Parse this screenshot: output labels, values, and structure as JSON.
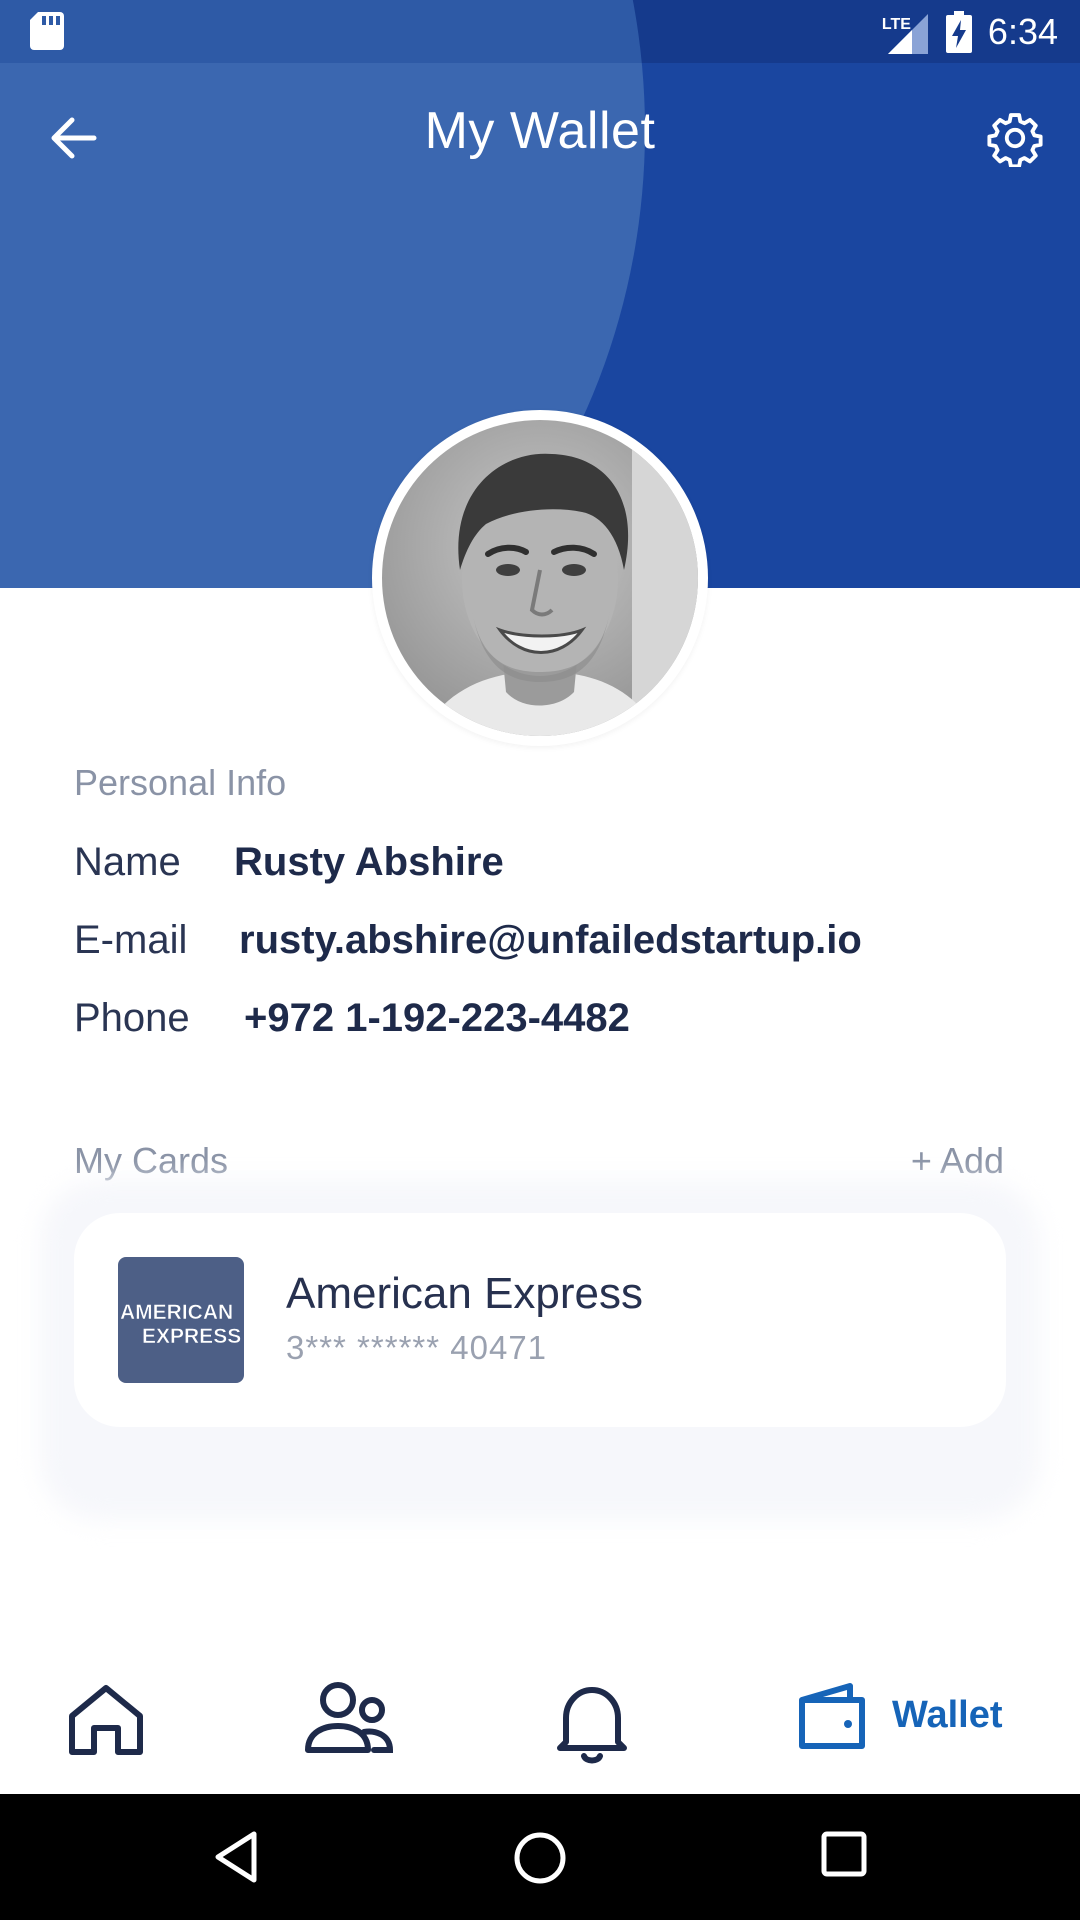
{
  "status_bar": {
    "network": "LTE",
    "time": "6:34"
  },
  "header": {
    "title": "My Wallet",
    "back_icon": "arrow-left-icon",
    "settings_icon": "gear-icon"
  },
  "profile": {
    "avatar_alt": "profile-photo"
  },
  "personal_info": {
    "section_label": "Personal Info",
    "name_label": "Name",
    "name_value": "Rusty Abshire",
    "email_label": "E-mail",
    "email_value": "rusty.abshire@unfailedstartup.io",
    "phone_label": "Phone",
    "phone_value": "+972 1-192-223-4482"
  },
  "cards": {
    "section_label": "My Cards",
    "add_label": "+ Add",
    "items": [
      {
        "name": "American Express",
        "number": "3*** ****** 40471",
        "logo_text_1": "AMERICAN",
        "logo_text_2": "EXPRESS"
      }
    ]
  },
  "bottom_nav": {
    "items": [
      {
        "icon": "home-icon",
        "label": ""
      },
      {
        "icon": "people-icon",
        "label": ""
      },
      {
        "icon": "bell-icon",
        "label": ""
      },
      {
        "icon": "wallet-icon",
        "label": "Wallet",
        "active": true
      }
    ]
  },
  "colors": {
    "header_blue": "#1a46a0",
    "accent": "#1664b8",
    "text_dark": "#1e2a4a",
    "text_muted": "#8a93a6"
  }
}
